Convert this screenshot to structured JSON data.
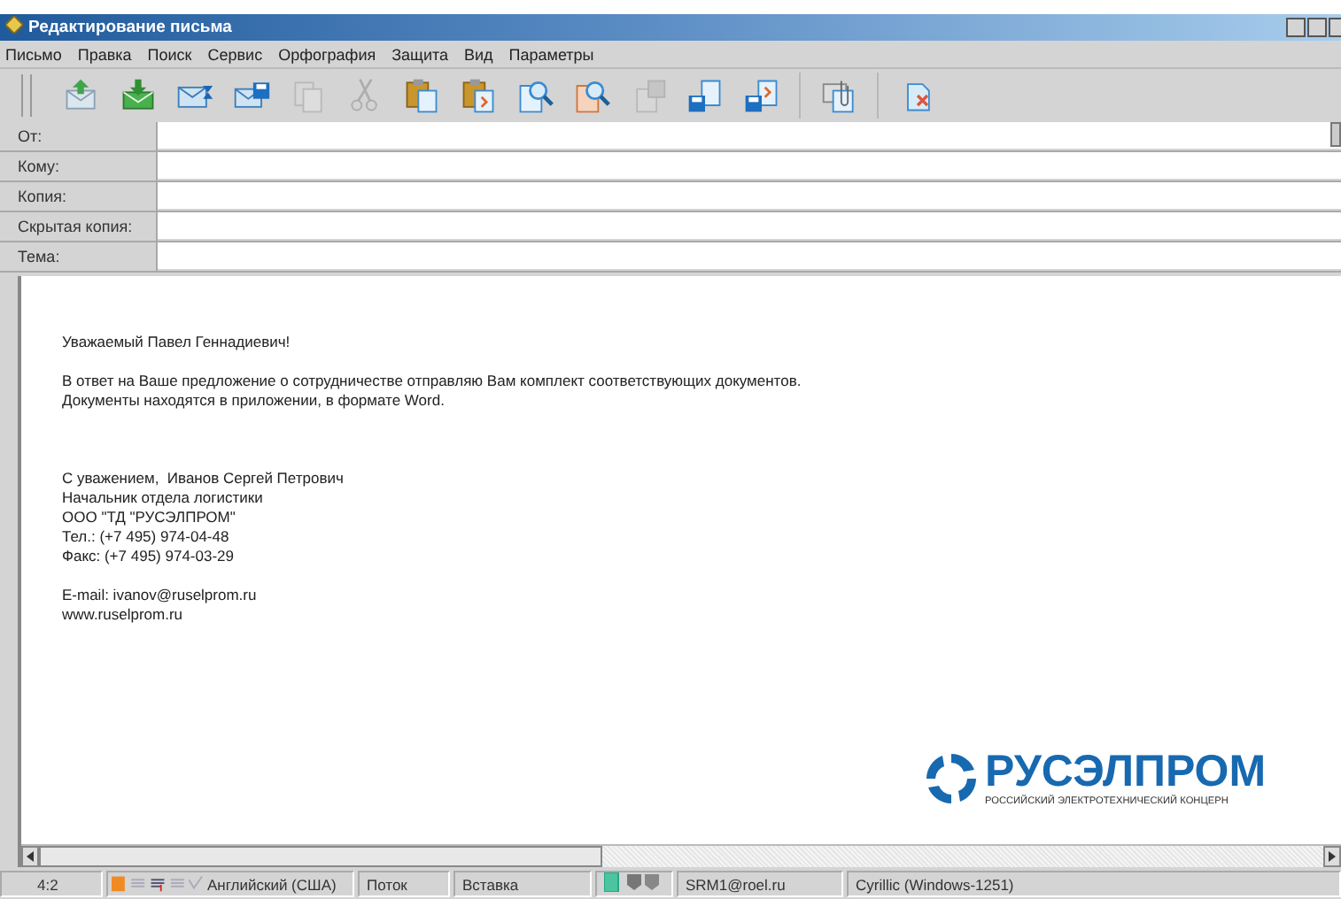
{
  "window": {
    "title": "Редактирование письма"
  },
  "menu": [
    {
      "label": "Письмо"
    },
    {
      "label": "Правка"
    },
    {
      "label": "Поиск"
    },
    {
      "label": "Сервис"
    },
    {
      "label": "Орфография"
    },
    {
      "label": "Защита"
    },
    {
      "label": "Вид"
    },
    {
      "label": "Параметры"
    }
  ],
  "toolbar": [
    [
      {
        "kind": "send",
        "disabled": false
      },
      {
        "kind": "receive",
        "disabled": false
      },
      {
        "kind": "postpone",
        "disabled": false
      },
      {
        "kind": "save-mail",
        "disabled": false
      },
      {
        "kind": "copy",
        "disabled": true
      },
      {
        "kind": "cut",
        "disabled": true
      },
      {
        "kind": "paste",
        "disabled": false
      },
      {
        "kind": "paste-special",
        "disabled": false
      },
      {
        "kind": "find",
        "disabled": false
      },
      {
        "kind": "find-next",
        "disabled": false
      },
      {
        "kind": "save",
        "disabled": true
      },
      {
        "kind": "save-as",
        "disabled": false
      },
      {
        "kind": "save-forward",
        "disabled": false
      }
    ],
    [
      {
        "kind": "attach",
        "disabled": false
      }
    ],
    [
      {
        "kind": "delete",
        "disabled": false
      }
    ]
  ],
  "header_fields": [
    {
      "label": "От:",
      "kind": "from"
    },
    {
      "label": "Кому:",
      "kind": "plain"
    },
    {
      "label": "Копия:",
      "kind": "plain"
    },
    {
      "label": "Скрытая копия:",
      "kind": "plain"
    },
    {
      "label": "Тема:",
      "kind": "plain"
    }
  ],
  "body": [
    {
      "kind": "greeting",
      "lines": [
        "Уважаемый Павел Геннадиевич!"
      ]
    },
    {
      "kind": "text",
      "lines": [
        "В ответ на Ваше предложение о сотрудничестве отправляю Вам комплект соответствующих документов.",
        "Документы находятся в приложении, в формате Word."
      ]
    },
    {
      "kind": "signature",
      "lines": [
        "С уважением,  Иванов Сергей Петрович",
        "Начальник отдела логистики",
        "ООО \"ТД \"РУСЭЛПРОМ\"",
        "Тел.: (+7 495) 974-04-48",
        "Факс: (+7 495) 974-03-29"
      ]
    },
    {
      "kind": "text",
      "lines": [
        "E-mail: ivanov@ruselprom.ru",
        "www.ruselprom.ru"
      ]
    }
  ],
  "logo": {
    "name": "РУСЭЛПРОМ",
    "tagline": "РОССИЙСКИЙ ЭЛЕКТРОТЕХНИЧЕСКИЙ КОНЦЕРН"
  },
  "status_bar": {
    "position": "4:2",
    "language": "Английский (США)",
    "mode": "Поток",
    "insert": "Вставка",
    "account": "SRM1@roel.ru",
    "encoding": "Cyrillic (Windows-1251)"
  }
}
